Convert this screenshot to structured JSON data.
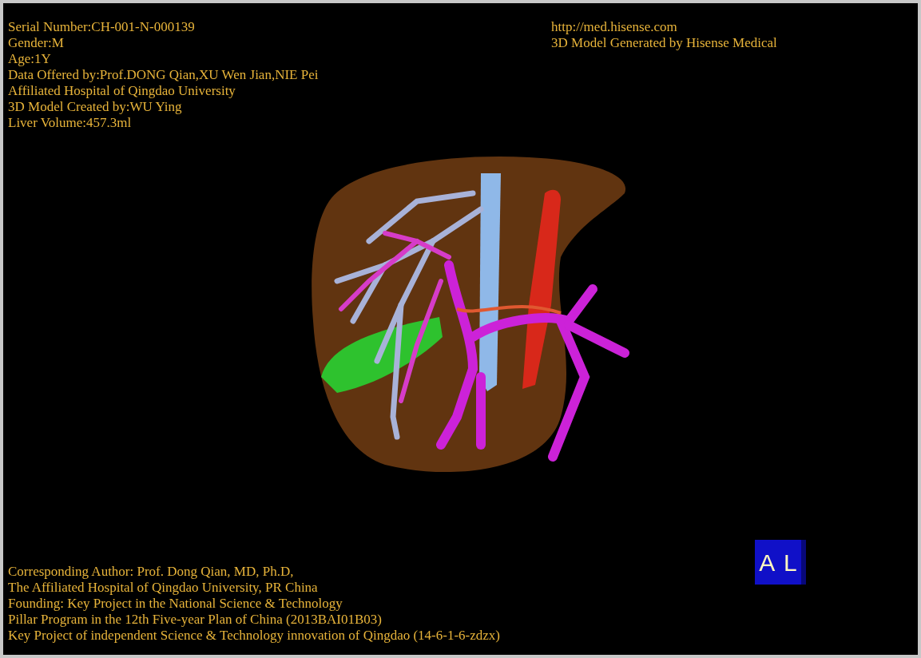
{
  "patient_info": [
    "Serial Number:CH-001-N-000139",
    "Gender:M",
    "Age:1Y",
    "Data Offered by:Prof.DONG Qian,XU Wen Jian,NIE Pei",
    "Affiliated Hospital of Qingdao University",
    "3D Model Created by:WU Ying",
    "Liver Volume:457.3ml"
  ],
  "generator_info": [
    "http://med.hisense.com",
    "3D Model Generated by Hisense Medical"
  ],
  "credits": [
    "Corresponding Author: Prof. Dong Qian, MD, Ph.D,",
    "The Affiliated Hospital of Qingdao University, PR China",
    "Founding: Key Project in the National Science & Technology",
    "Pillar Program in the 12th Five-year Plan of China (2013BAI01B03)",
    "Key Project of independent Science & Technology innovation of Qingdao (14-6-1-6-zdzx)"
  ],
  "orientation_cube": {
    "front_label": "A",
    "side_label": "L"
  }
}
